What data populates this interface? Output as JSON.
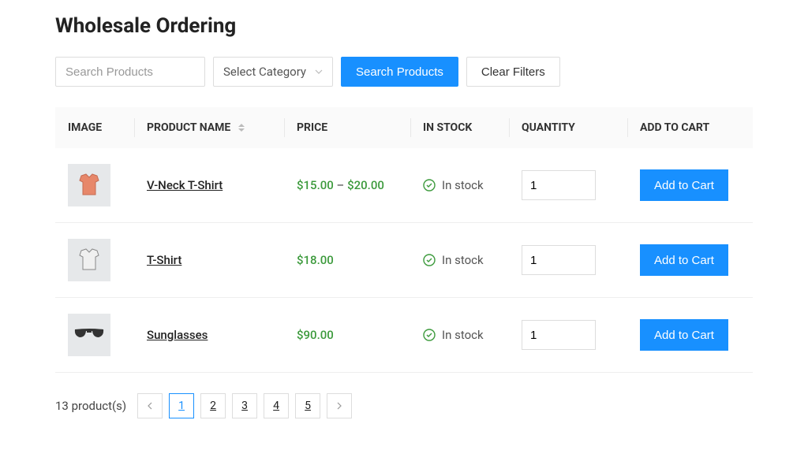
{
  "title": "Wholesale Ordering",
  "toolbar": {
    "search_placeholder": "Search Products",
    "category_placeholder": "Select Category",
    "search_button": "Search Products",
    "clear_button": "Clear Filters"
  },
  "columns": {
    "image": "IMAGE",
    "name": "PRODUCT NAME",
    "price": "PRICE",
    "stock": "IN STOCK",
    "quantity": "QUANTITY",
    "add": "ADD TO CART"
  },
  "stock_label": "In stock",
  "add_label": "Add to Cart",
  "products": [
    {
      "name": "V-Neck T-Shirt",
      "price_low": "$15.00",
      "price_high": "$20.00",
      "qty": "1",
      "image": "tshirt-orange"
    },
    {
      "name": "T-Shirt",
      "price_low": "$18.00",
      "price_high": null,
      "qty": "1",
      "image": "tshirt-white"
    },
    {
      "name": "Sunglasses",
      "price_low": "$90.00",
      "price_high": null,
      "qty": "1",
      "image": "sunglasses"
    }
  ],
  "pagination": {
    "count_text": "13 product(s)",
    "pages": [
      "1",
      "2",
      "3",
      "4",
      "5"
    ],
    "current": "1"
  }
}
